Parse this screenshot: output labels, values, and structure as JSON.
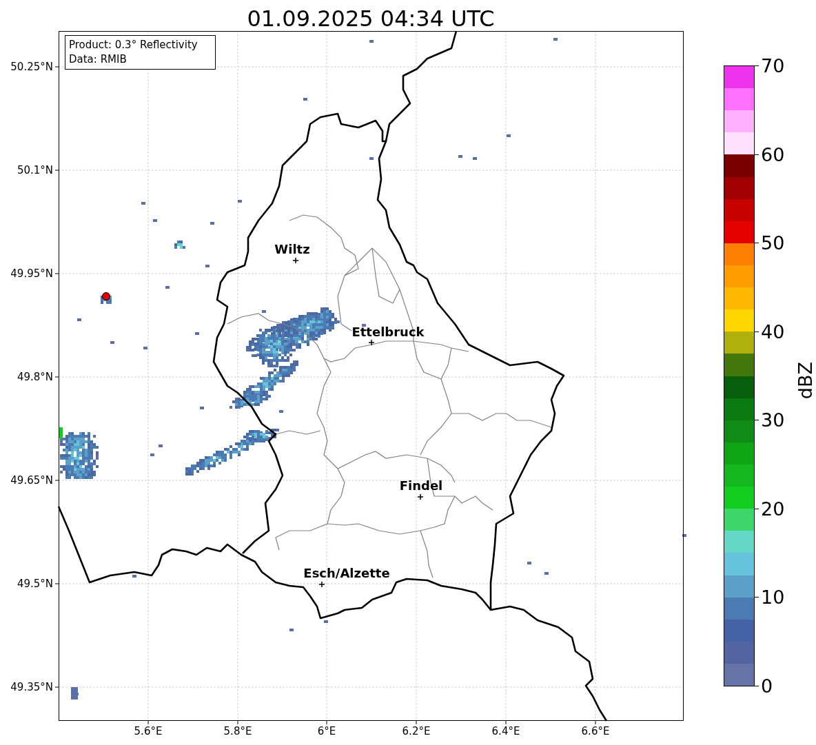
{
  "title": "01.09.2025 04:34 UTC",
  "info_box": {
    "lines": [
      "Product: 0.3° Reflectivity",
      "Data: RMIB"
    ]
  },
  "map": {
    "x_ticks": [
      "5.6°E",
      "5.8°E",
      "6°E",
      "6.2°E",
      "6.4°E",
      "6.6°E"
    ],
    "y_ticks": [
      "50.25°N",
      "50.1°N",
      "49.95°N",
      "49.8°N",
      "49.65°N",
      "49.5°N",
      "49.35°N"
    ],
    "cities": [
      {
        "name": "Wiltz"
      },
      {
        "name": "Ettelbruck"
      },
      {
        "name": "Findel"
      },
      {
        "name": "Esch/Alzette"
      }
    ]
  },
  "colorbar": {
    "label": "dBZ",
    "ticks": [
      "70",
      "60",
      "50",
      "40",
      "30",
      "20",
      "10",
      "0"
    ],
    "segments": [
      {
        "color": "#ee33ee"
      },
      {
        "color": "#ff70ff"
      },
      {
        "color": "#ffb0ff"
      },
      {
        "color": "#ffe0ff"
      },
      {
        "color": "#7a0000"
      },
      {
        "color": "#a00000"
      },
      {
        "color": "#c80000"
      },
      {
        "color": "#e50000"
      },
      {
        "color": "#ff7f00"
      },
      {
        "color": "#ff9c00"
      },
      {
        "color": "#ffb800"
      },
      {
        "color": "#ffd700"
      },
      {
        "color": "#b0b00a"
      },
      {
        "color": "#44770c"
      },
      {
        "color": "#075f0c"
      },
      {
        "color": "#0b7a13"
      },
      {
        "color": "#0e8c16"
      },
      {
        "color": "#0fa514"
      },
      {
        "color": "#12b81e"
      },
      {
        "color": "#12cc1e"
      },
      {
        "color": "#3dd66b"
      },
      {
        "color": "#64d8c6"
      },
      {
        "color": "#66c3db"
      },
      {
        "color": "#5ba0c8"
      },
      {
        "color": "#4a7cb3"
      },
      {
        "color": "#4562a6"
      },
      {
        "color": "#5265a0"
      },
      {
        "color": "#6673a8"
      }
    ]
  }
}
